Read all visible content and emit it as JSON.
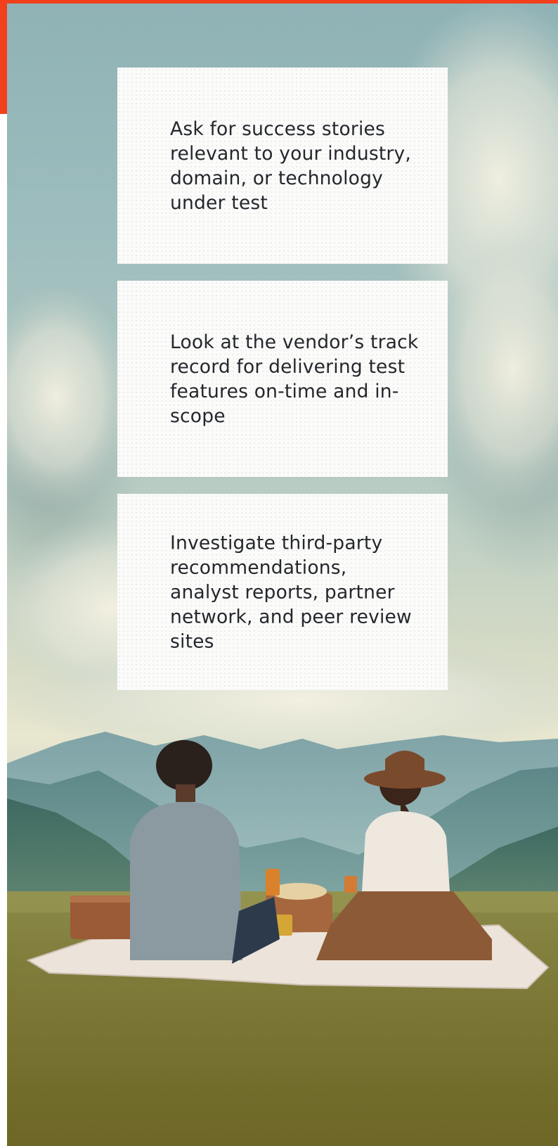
{
  "colors": {
    "accent": "#f2401c",
    "card_background": "#fbfbfa",
    "card_text": "#24272c"
  },
  "cards": [
    {
      "text": "Ask for success stories relevant to your industry, domain, or technology under test"
    },
    {
      "text": "Look at the vendor’s track record for delivering test features on-time and in-scope"
    },
    {
      "text": "Investigate third-party recommendations, analyst reports, partner network, and peer review sites"
    }
  ]
}
